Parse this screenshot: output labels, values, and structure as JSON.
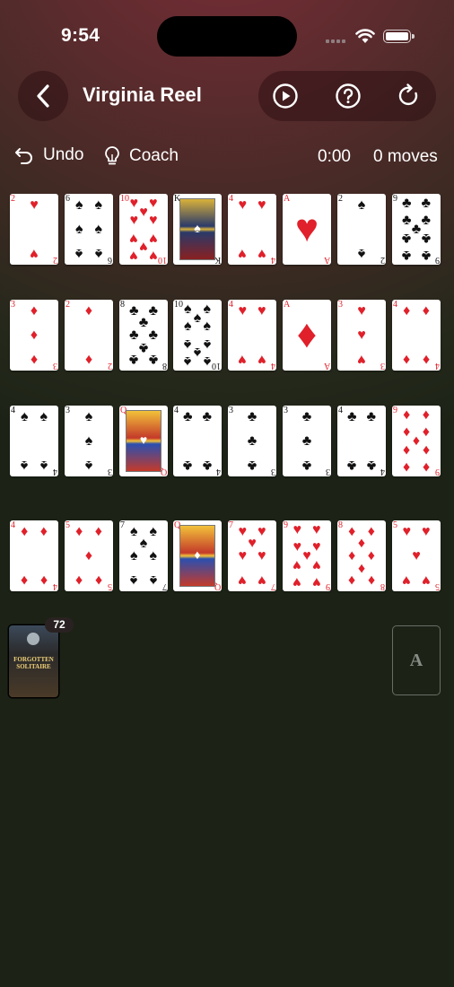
{
  "status": {
    "time": "9:54"
  },
  "header": {
    "title": "Virginia Reel"
  },
  "toolbar": {
    "undo_label": "Undo",
    "coach_label": "Coach",
    "timer": "0:00",
    "moves": "0 moves"
  },
  "tableau": [
    [
      {
        "rank": "2",
        "suit": "♥"
      },
      {
        "rank": "6",
        "suit": "♠"
      },
      {
        "rank": "10",
        "suit": "♥"
      },
      {
        "rank": "K",
        "suit": "♠"
      },
      {
        "rank": "4",
        "suit": "♥"
      },
      {
        "rank": "A",
        "suit": "♥"
      },
      {
        "rank": "2",
        "suit": "♠"
      },
      {
        "rank": "9",
        "suit": "♣"
      }
    ],
    [
      {
        "rank": "3",
        "suit": "♦"
      },
      {
        "rank": "2",
        "suit": "♦"
      },
      {
        "rank": "8",
        "suit": "♣"
      },
      {
        "rank": "10",
        "suit": "♠"
      },
      {
        "rank": "4",
        "suit": "♥"
      },
      {
        "rank": "A",
        "suit": "♦"
      },
      {
        "rank": "3",
        "suit": "♥"
      },
      {
        "rank": "4",
        "suit": "♦"
      }
    ],
    [
      {
        "rank": "4",
        "suit": "♠"
      },
      {
        "rank": "3",
        "suit": "♠"
      },
      {
        "rank": "Q",
        "suit": "♥"
      },
      {
        "rank": "4",
        "suit": "♣"
      },
      {
        "rank": "3",
        "suit": "♣"
      },
      {
        "rank": "3",
        "suit": "♣"
      },
      {
        "rank": "4",
        "suit": "♣"
      },
      {
        "rank": "9",
        "suit": "♦"
      }
    ],
    [
      {
        "rank": "4",
        "suit": "♦"
      },
      {
        "rank": "5",
        "suit": "♦"
      },
      {
        "rank": "7",
        "suit": "♠"
      },
      {
        "rank": "Q",
        "suit": "♦"
      },
      {
        "rank": "7",
        "suit": "♥"
      },
      {
        "rank": "9",
        "suit": "♥"
      },
      {
        "rank": "8",
        "suit": "♦"
      },
      {
        "rank": "5",
        "suit": "♥"
      }
    ]
  ],
  "stock": {
    "count": "72",
    "line1": "FORGOTTEN",
    "line2": "SOLITAIRE"
  },
  "foundation": {
    "label": "A"
  }
}
